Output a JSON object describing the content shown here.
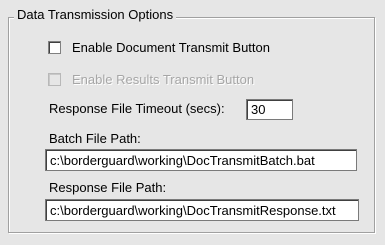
{
  "group": {
    "title": "Data Transmission Options"
  },
  "options": {
    "enable_document_transmit": {
      "label": "Enable Document Transmit Button",
      "checked": false,
      "enabled": true
    },
    "enable_results_transmit": {
      "label": "Enable Results Transmit Button",
      "checked": false,
      "enabled": false
    }
  },
  "timeout": {
    "label": "Response File Timeout (secs):",
    "value": "30"
  },
  "batch_path": {
    "label": "Batch File Path:",
    "value": "c:\\borderguard\\working\\DocTransmitBatch.bat"
  },
  "response_path": {
    "label": "Response File Path:",
    "value": "c:\\borderguard\\working\\DocTransmitResponse.txt"
  }
}
